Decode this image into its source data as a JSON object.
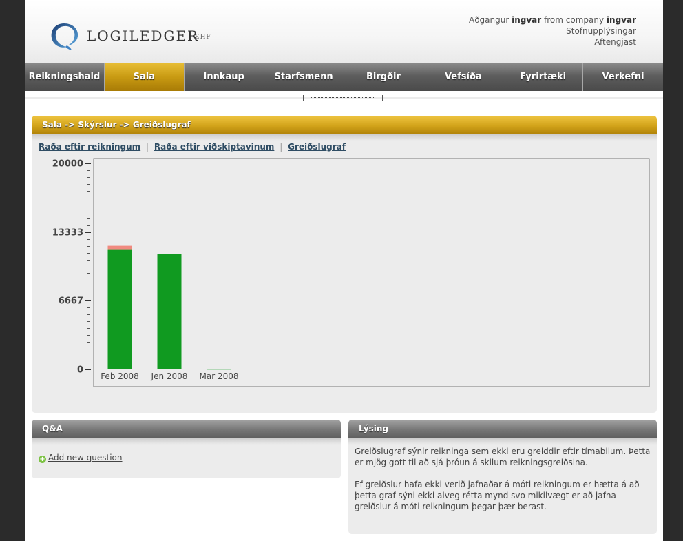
{
  "header": {
    "brand": "LOGILEDGER",
    "brand_suffix": "EHF",
    "account_prefix": "Aðgangur",
    "account_user": "ingvar",
    "account_mid": "from company",
    "account_company": "ingvar",
    "link_info": "Stofnupplýsingar",
    "link_logout": "Aftengjast"
  },
  "nav": {
    "items": [
      {
        "label": "Reikningshald"
      },
      {
        "label": "Sala"
      },
      {
        "label": "Innkaup"
      },
      {
        "label": "Starfsmenn"
      },
      {
        "label": "Birgðir"
      },
      {
        "label": "Vefsíða"
      },
      {
        "label": "Fyrirtæki"
      },
      {
        "label": "Verkefni"
      }
    ],
    "active": "Sala"
  },
  "main": {
    "breadcrumb": "Sala -> Skýrslur -> Greiðslugraf",
    "links": {
      "by_invoice": "Raða eftir reikningum",
      "by_customer": "Raða eftir viðskiptavinum",
      "graph": "Greiðslugraf",
      "separator": "|"
    }
  },
  "chart_data": {
    "type": "bar",
    "stacked": true,
    "categories": [
      "Feb 2008",
      "Jen 2008",
      "Mar 2008"
    ],
    "series": [
      {
        "values": [
          11600,
          11200,
          50
        ],
        "color": "#109a20"
      },
      {
        "values": [
          400,
          0,
          0
        ],
        "color": "#f08a80"
      }
    ],
    "ylim": [
      0,
      20000
    ],
    "yticks": [
      "20000",
      "13333",
      "6667",
      "0"
    ],
    "ytick_values": [
      20000,
      13333,
      6667,
      0
    ],
    "minor_ticks": 30
  },
  "qa": {
    "title": "Q&A",
    "add_label": "Add new question",
    "add_icon": "plus-circle-icon"
  },
  "description": {
    "title": "Lýsing",
    "p1": "Greiðslugraf sýnir reikninga sem ekki eru greiddir eftir tímabilum. Þetta er mjög gott til að sjá þróun á skilum reikningsgreiðslna.",
    "p2": "Ef greiðslur hafa ekki verið jafnaðar á móti reikningum er hætta á að þetta graf sýni ekki alveg rétta mynd svo mikilvægt er að jafna greiðslur á móti reikningum þegar þær berast."
  },
  "colors": {
    "accent": "#d3a41b",
    "bar_paid": "#109a20",
    "bar_unpaid": "#f08a80"
  }
}
